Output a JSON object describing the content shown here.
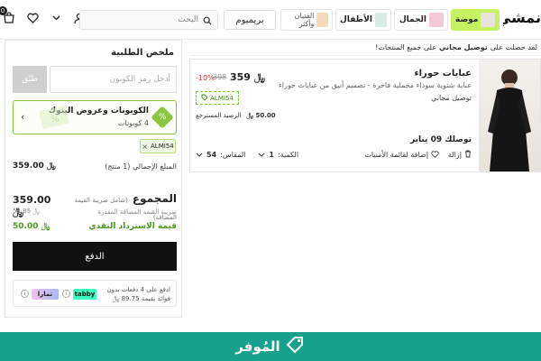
{
  "header": {
    "cart_count": "0",
    "search_placeholder": "البحث",
    "premium_label": "بريميوم",
    "categories": {
      "teens": "الفتيان وأكثر",
      "kids": "الأطفال",
      "beauty": "الجمال",
      "fashion": "موضة"
    },
    "logo_text": "نمشي"
  },
  "promo": {
    "prefix": "لقد حصلت على",
    "highlight": "توصيل مجاني",
    "suffix": "على جميع المنتجات!"
  },
  "product": {
    "name": "عبايات حوراء",
    "description": "عباية شتوية سوداء مخملية فاخرة - تصميم أنيق من عبايات حوراء",
    "shipping": "توصيل مجاني",
    "price_now": "359",
    "price_old": "398",
    "discount": "-10%",
    "currency": "﷼",
    "coupon_code": "ALMI54",
    "earned_label": "الرصيد المسترجع",
    "earned_value": "50.00 ﷼",
    "delivery": "توصلك 09 يناير",
    "qty_label": "الكمية:",
    "qty_value": "1",
    "size_label": "المقاس:",
    "size_value": "54",
    "remove_label": "إزالة",
    "wishlist_label": "إضافة لقائمة الأمنيات"
  },
  "summary": {
    "title": "ملخص الطلبية",
    "coupon_placeholder": "أدخل رمز الكوبون",
    "apply_label": "طبّق",
    "coupon_card_title": "الكوبونات وعروض البنوك",
    "coupon_card_sub": "4 كوبونات",
    "applied_code": "ALMI54",
    "subtotal_label": "المبلغ الإجمالي (1 منتج)",
    "subtotal_value": "359.00 ﷼",
    "total_label": "المجموع",
    "total_note": "(شامل ضريبة القيمة المضافة)",
    "total_value": "359.00 ﷼",
    "vat_label": "ضريبة القيمة المضافة المقدرة",
    "vat_value": "53.85 ﷼",
    "cashback_label": "قيمة الاسترداد النقدي",
    "cashback_value": "50.00 ﷼",
    "pay_label": "الدفع",
    "installment_line1": "ادفع على 4 دفعات بدون",
    "installment_line2": "فوائد بقيمة 89.75 ﷼",
    "tabby_label": "tabby",
    "tamara_label": "تمارا"
  },
  "footer": {
    "brand": "المُوفر"
  },
  "colors": {
    "accent_green": "#8cc63f",
    "fashion_tab": "#c6f160",
    "footer_bg": "#17a08c",
    "discount_red": "#d23b3b",
    "cashback_green": "#4a9a1c"
  },
  "icons": [
    "cart-icon",
    "heart-icon",
    "user-icon",
    "chevron-down-icon",
    "search-icon",
    "tag-icon",
    "close-icon",
    "trash-icon",
    "info-icon"
  ]
}
